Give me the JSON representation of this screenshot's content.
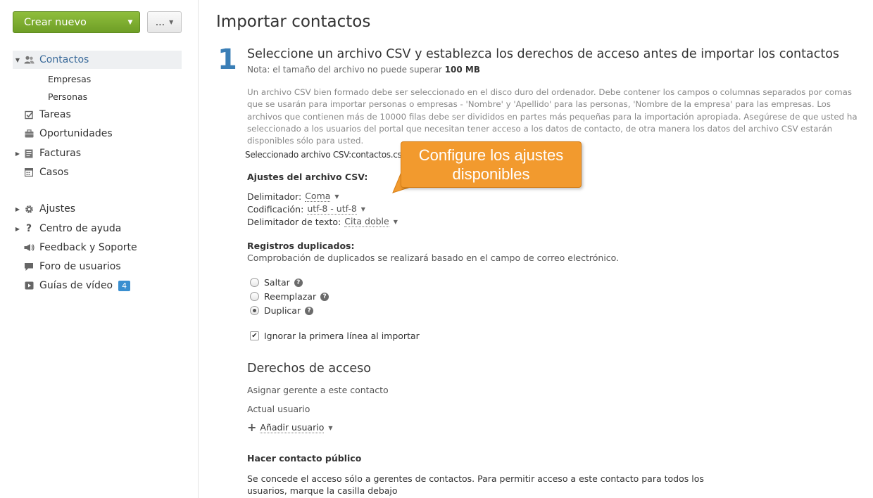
{
  "sidebar": {
    "create_label": "Crear nuevo",
    "more_label": "...",
    "items": [
      {
        "label": "Contactos"
      },
      {
        "label": "Empresas"
      },
      {
        "label": "Personas"
      },
      {
        "label": "Tareas"
      },
      {
        "label": "Oportunidades"
      },
      {
        "label": "Facturas"
      },
      {
        "label": "Casos"
      },
      {
        "label": "Ajustes"
      },
      {
        "label": "Centro de ayuda"
      },
      {
        "label": "Feedback y Soporte"
      },
      {
        "label": "Foro de usuarios"
      },
      {
        "label": "Guías de vídeo",
        "badge": "4"
      }
    ]
  },
  "main": {
    "title": "Importar contactos",
    "step_number": "1",
    "step_title": "Seleccione un archivo CSV y establezca los derechos de acceso antes de importar los contactos",
    "note_prefix": "Nota: el tamaño del archivo no puede superar",
    "note_size": "100 MB",
    "description": "Un archivo CSV bien formado debe ser seleccionado en el disco duro del ordenador. Debe contener los campos o columnas separados por comas que se usarán para importar personas o empresas - 'Nombre' y 'Apellido' para las personas, 'Nombre de la empresa' para las empresas. Los archivos que contienen más de 10000 filas debe ser divididos en partes más pequeñas para la importación apropiada. Asegúrese de que usted ha seleccionado a los usuarios del portal que necesitan tener acceso a los datos de contacto, de otra manera los datos del archivo CSV estarán disponibles sólo para usted.",
    "selected_file": "Seleccionado archivo CSV:contactos.csv",
    "csv_settings_heading": "Ajustes del archivo CSV:",
    "delimiter_label": "Delimitador:",
    "delimiter_value": "Coma",
    "encoding_label": "Codificación:",
    "encoding_value": "utf-8 - utf-8",
    "text_delimiter_label": "Delimitador de texto:",
    "text_delimiter_value": "Cita doble",
    "duplicates_heading": "Registros duplicados:",
    "duplicates_note": "Comprobación de duplicados se realizará basado en el campo de correo electrónico.",
    "radio_skip": "Saltar",
    "radio_replace": "Reemplazar",
    "radio_duplicate": "Duplicar",
    "ignore_first_line": "Ignorar la primera línea al importar",
    "access_heading": "Derechos de acceso",
    "assign_manager": "Asignar gerente a este contacto",
    "current_user": "Actual usuario",
    "add_user": "Añadir usuario",
    "public_heading": "Hacer contacto público",
    "public_text": "Se concede el acceso sólo a gerentes de contactos. Para permitir acceso a este contacto para todos los usuarios, marque la casilla debajo"
  },
  "callout": {
    "text_line1": "Configure los ajustes",
    "text_line2": "disponibles"
  },
  "colors": {
    "accent_green": "#7aad2d",
    "link_blue": "#3a6a9a",
    "step_blue": "#3a7eb6",
    "callout_orange": "#f29a2e",
    "badge_blue": "#3a8fd0"
  }
}
